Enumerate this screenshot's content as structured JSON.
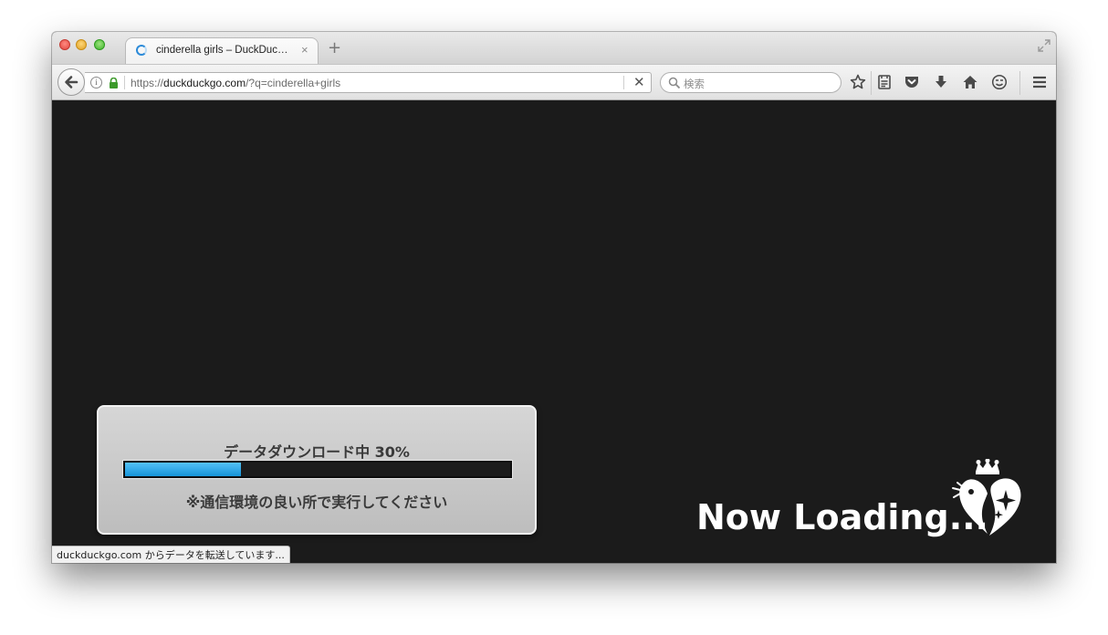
{
  "browser": {
    "tab": {
      "title": "cinderella girls – DuckDuc…",
      "close_glyph": "×"
    },
    "new_tab_glyph": "+",
    "url": {
      "scheme": "https://",
      "domain": "duckduckgo.com",
      "path": "/?q=cinderella+girls"
    },
    "search": {
      "placeholder": "検索"
    },
    "toolbar_icons": [
      "bookmark-star-icon",
      "reading-list-icon",
      "pocket-icon",
      "download-icon",
      "home-icon",
      "emoji-icon",
      "menu-icon"
    ]
  },
  "page": {
    "loader": {
      "label": "データダウンロード中 30%",
      "progress": 0.3,
      "notice": "※通信環境の良い所で実行してください"
    },
    "loading_text": "Now Loading...",
    "logo": "cinderella-heart-crown-logo"
  },
  "status_bar": {
    "text": "duckduckgo.com からデータを転送しています..."
  },
  "colors": {
    "page_background": "#1b1b1b",
    "progress_fill": "#2aa6ea",
    "dialog_background": "#c8c8c8"
  }
}
